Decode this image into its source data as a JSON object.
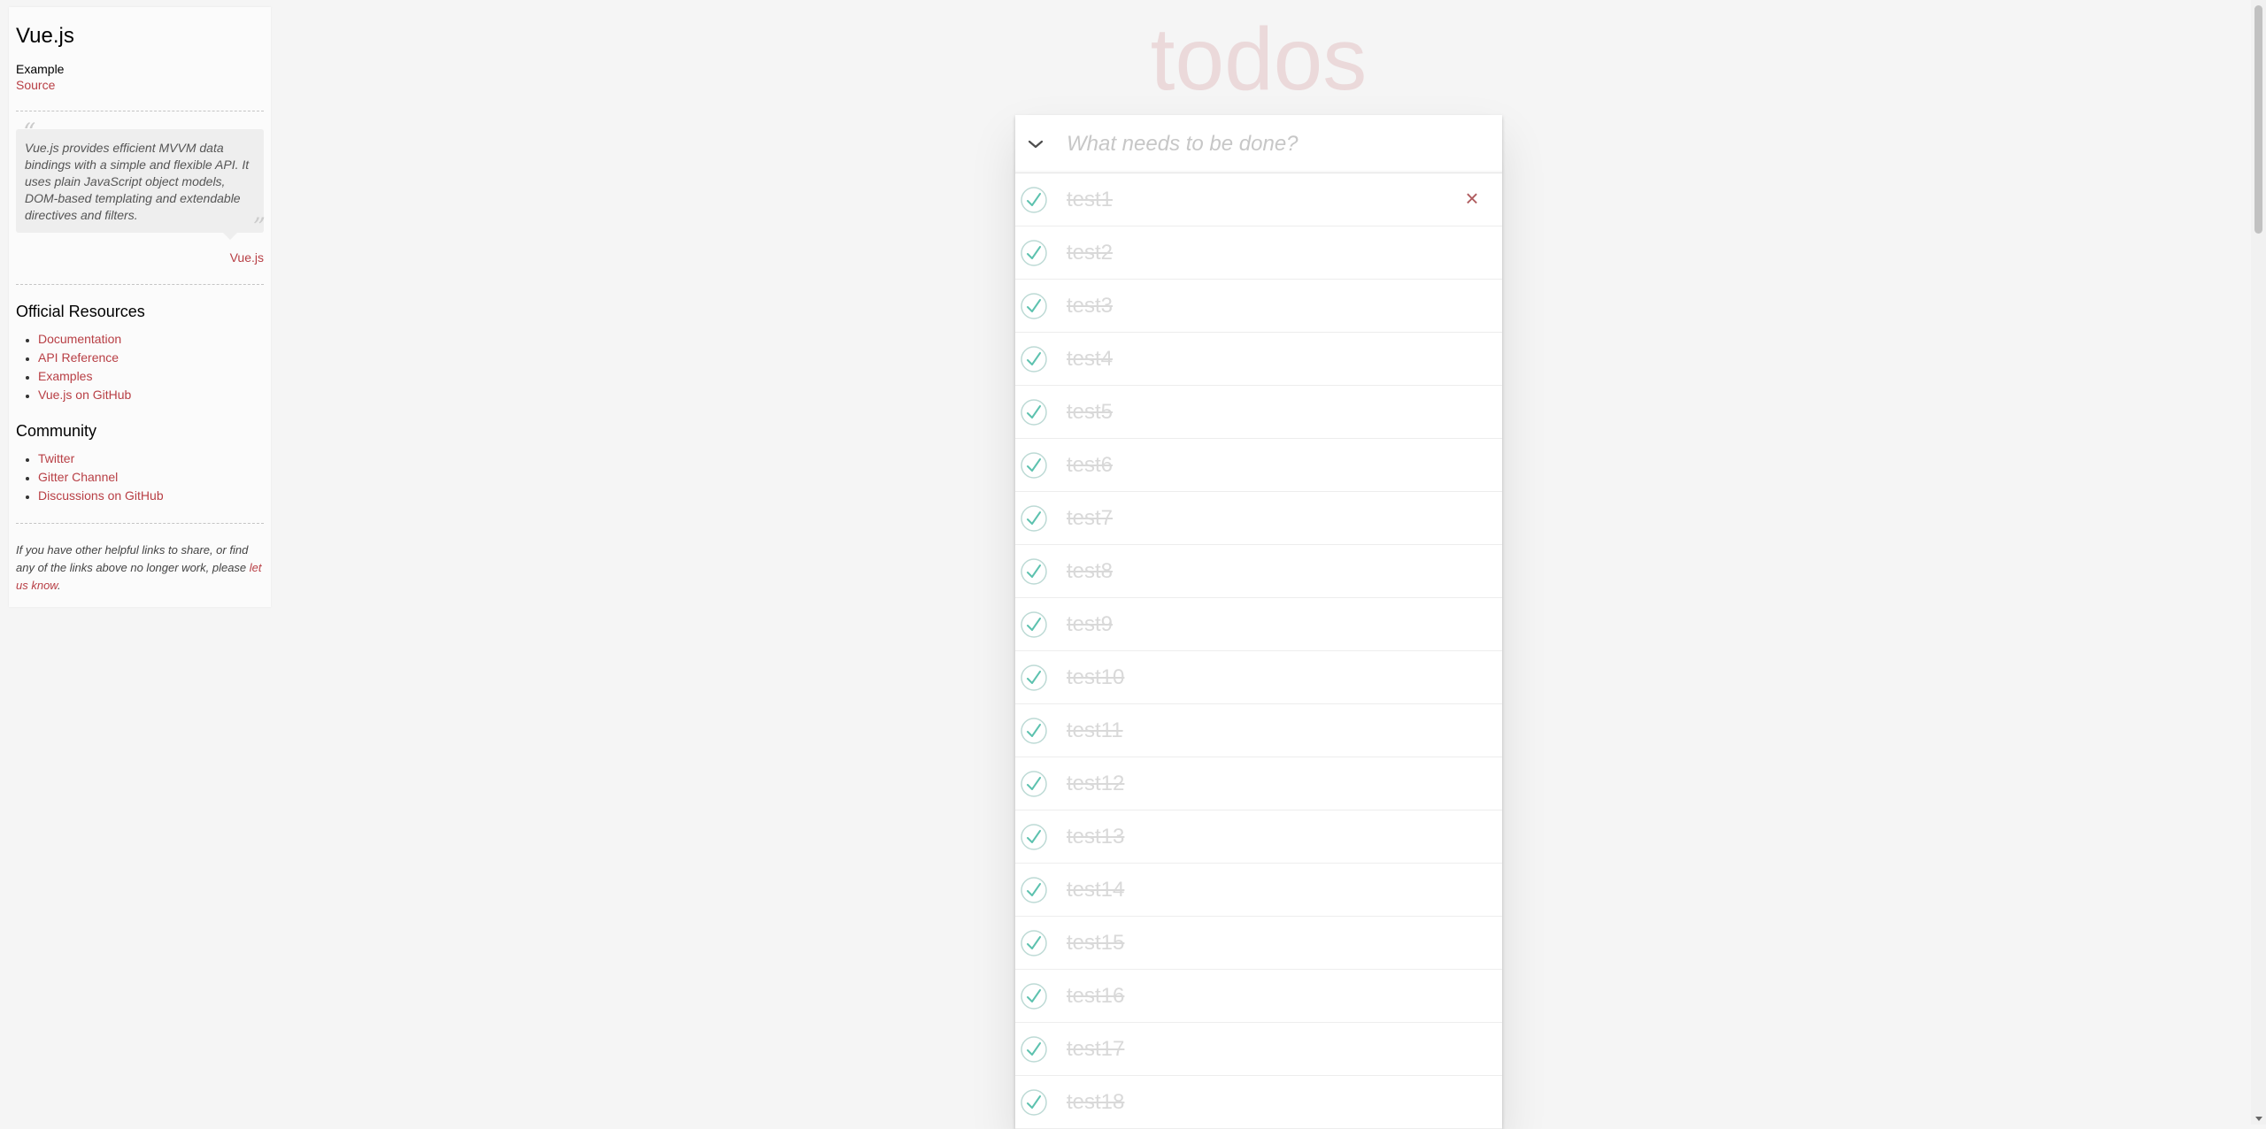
{
  "sidebar": {
    "title": "Vue.js",
    "subtitle": "Example",
    "source_link": "Source",
    "quote": "Vue.js provides efficient MVVM data bindings with a simple and flexible API. It uses plain JavaScript object models, DOM-based templating and extendable directives and filters.",
    "quote_attribution": "Vue.js",
    "official_heading": "Official Resources",
    "official_links": [
      "Documentation",
      "API Reference",
      "Examples",
      "Vue.js on GitHub"
    ],
    "community_heading": "Community",
    "community_links": [
      "Twitter",
      "Gitter Channel",
      "Discussions on GitHub"
    ],
    "footer_text_1": "If you have other helpful links to share, or find any of the links above no longer work, please ",
    "footer_link": "let us know",
    "footer_text_2": "."
  },
  "app": {
    "title": "todos",
    "new_todo_placeholder": "What needs to be done?",
    "todos": [
      {
        "label": "test1",
        "completed": true
      },
      {
        "label": "test2",
        "completed": true
      },
      {
        "label": "test3",
        "completed": true
      },
      {
        "label": "test4",
        "completed": true
      },
      {
        "label": "test5",
        "completed": true
      },
      {
        "label": "test6",
        "completed": true
      },
      {
        "label": "test7",
        "completed": true
      },
      {
        "label": "test8",
        "completed": true
      },
      {
        "label": "test9",
        "completed": true
      },
      {
        "label": "test10",
        "completed": true
      },
      {
        "label": "test11",
        "completed": true
      },
      {
        "label": "test12",
        "completed": true
      },
      {
        "label": "test13",
        "completed": true
      },
      {
        "label": "test14",
        "completed": true
      },
      {
        "label": "test15",
        "completed": true
      },
      {
        "label": "test16",
        "completed": true
      },
      {
        "label": "test17",
        "completed": true
      },
      {
        "label": "test18",
        "completed": true
      }
    ],
    "destroy_glyph": "×",
    "colors": {
      "accent": "#b83f45",
      "check": "#5dc2af",
      "check_ring": "#bddad5",
      "completed_text": "#d9d9d9"
    }
  }
}
